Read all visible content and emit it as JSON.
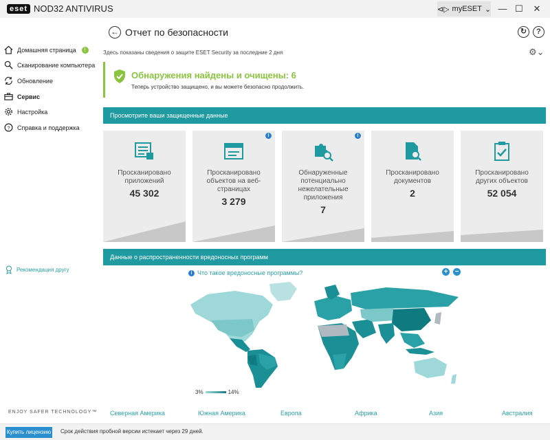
{
  "app": {
    "logo_mark": "eset",
    "logo_text": "NOD32 ANTIVIRUS",
    "myeset_label": "myESET",
    "window_controls": {
      "minimize": "—",
      "maximize": "☐",
      "close": "✕"
    }
  },
  "sidebar": {
    "items": [
      {
        "label": "Домашняя страница",
        "icon": "home-icon",
        "badge": "!"
      },
      {
        "label": "Сканирование компьютера",
        "icon": "search-icon"
      },
      {
        "label": "Обновление",
        "icon": "refresh-icon"
      },
      {
        "label": "Сервис",
        "icon": "briefcase-icon",
        "active": true
      },
      {
        "label": "Настройка",
        "icon": "gear-icon"
      },
      {
        "label": "Справка и поддержка",
        "icon": "help-icon"
      }
    ],
    "recommend": "Рекомендация другу",
    "tagline": "ENJOY SAFER TECHNOLOGY™"
  },
  "main": {
    "title": "Отчет по безопасности",
    "subtitle": "Здесь показаны сведения о защите ESET Security за последние 2 дня",
    "detection": {
      "title": "Обнаружения найдены и очищены: 6",
      "subtitle": "Теперь устройство защищено, и вы можете безопасно продолжить."
    },
    "protected_header": "Просмотрите ваши защищенные данные",
    "tiles": [
      {
        "label_lines": [
          "Просканировано",
          "приложений"
        ],
        "value": "45 302",
        "info": false
      },
      {
        "label_lines": [
          "Просканировано",
          "объектов на веб-",
          "страницах"
        ],
        "value": "3 279",
        "info": true
      },
      {
        "label_lines": [
          "Обнаруженные",
          "потенциально",
          "нежелательные",
          "приложения"
        ],
        "value": "7",
        "info": true
      },
      {
        "label_lines": [
          "Просканировано",
          "документов"
        ],
        "value": "2",
        "info": false
      },
      {
        "label_lines": [
          "Просканировано",
          "других объектов"
        ],
        "value": "52 054",
        "info": false
      }
    ],
    "malware_header": "Данные о распространенности вредоносных программ",
    "whatis_link": "Что такое вредоносные программы?",
    "legend": {
      "min": "3%",
      "max": "14%"
    },
    "regions": [
      "Северная Америка",
      "Южная Америка",
      "Европа",
      "Африка",
      "Азия",
      "Австралия"
    ]
  },
  "footer": {
    "buy_button": "Купить лицензию",
    "trial_text": "Срок действия пробной версии истекает через 29 дней."
  },
  "colors": {
    "accent_teal": "#1f9aa0",
    "success_green": "#8ac43f",
    "link_blue": "#2a8fcf"
  }
}
